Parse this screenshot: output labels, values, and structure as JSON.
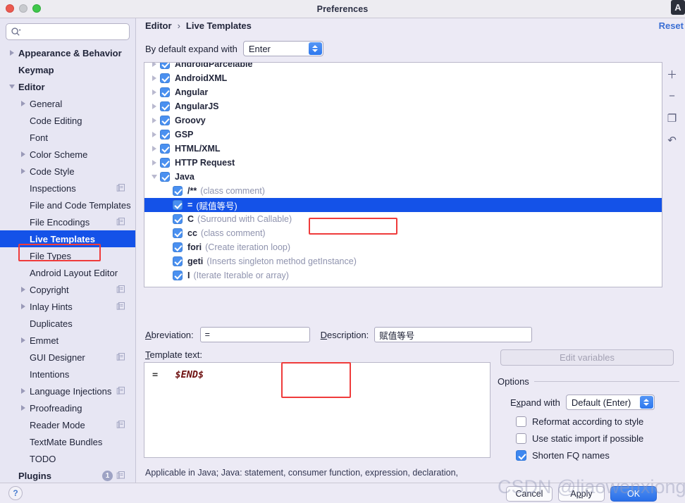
{
  "window": {
    "title": "Preferences",
    "corner_badge": "A",
    "traffic_lights": [
      "close-red",
      "minimize-gray",
      "maximize-green"
    ]
  },
  "sidebar": {
    "search": {
      "value": "",
      "placeholder": "",
      "icon": "search-icon"
    },
    "items": [
      {
        "label": "Appearance & Behavior",
        "arrow": "right",
        "indent": 1,
        "bold": true,
        "copy": false,
        "selected": false
      },
      {
        "label": "Keymap",
        "arrow": "none",
        "indent": 1,
        "bold": true,
        "copy": false,
        "selected": false
      },
      {
        "label": "Editor",
        "arrow": "down",
        "indent": 1,
        "bold": true,
        "copy": false,
        "selected": false
      },
      {
        "label": "General",
        "arrow": "right",
        "indent": 2,
        "bold": false,
        "copy": false,
        "selected": false
      },
      {
        "label": "Code Editing",
        "arrow": "none",
        "indent": 2,
        "bold": false,
        "copy": false,
        "selected": false
      },
      {
        "label": "Font",
        "arrow": "none",
        "indent": 2,
        "bold": false,
        "copy": false,
        "selected": false
      },
      {
        "label": "Color Scheme",
        "arrow": "right",
        "indent": 2,
        "bold": false,
        "copy": false,
        "selected": false
      },
      {
        "label": "Code Style",
        "arrow": "right",
        "indent": 2,
        "bold": false,
        "copy": false,
        "selected": false
      },
      {
        "label": "Inspections",
        "arrow": "none",
        "indent": 2,
        "bold": false,
        "copy": true,
        "selected": false
      },
      {
        "label": "File and Code Templates",
        "arrow": "none",
        "indent": 2,
        "bold": false,
        "copy": false,
        "selected": false
      },
      {
        "label": "File Encodings",
        "arrow": "none",
        "indent": 2,
        "bold": false,
        "copy": true,
        "selected": false
      },
      {
        "label": "Live Templates",
        "arrow": "none",
        "indent": 2,
        "bold": true,
        "copy": false,
        "selected": true
      },
      {
        "label": "File Types",
        "arrow": "none",
        "indent": 2,
        "bold": false,
        "copy": false,
        "selected": false
      },
      {
        "label": "Android Layout Editor",
        "arrow": "none",
        "indent": 2,
        "bold": false,
        "copy": false,
        "selected": false
      },
      {
        "label": "Copyright",
        "arrow": "right",
        "indent": 2,
        "bold": false,
        "copy": true,
        "selected": false
      },
      {
        "label": "Inlay Hints",
        "arrow": "right",
        "indent": 2,
        "bold": false,
        "copy": true,
        "selected": false
      },
      {
        "label": "Duplicates",
        "arrow": "none",
        "indent": 2,
        "bold": false,
        "copy": false,
        "selected": false
      },
      {
        "label": "Emmet",
        "arrow": "right",
        "indent": 2,
        "bold": false,
        "copy": false,
        "selected": false
      },
      {
        "label": "GUI Designer",
        "arrow": "none",
        "indent": 2,
        "bold": false,
        "copy": true,
        "selected": false
      },
      {
        "label": "Intentions",
        "arrow": "none",
        "indent": 2,
        "bold": false,
        "copy": false,
        "selected": false
      },
      {
        "label": "Language Injections",
        "arrow": "right",
        "indent": 2,
        "bold": false,
        "copy": true,
        "selected": false
      },
      {
        "label": "Proofreading",
        "arrow": "right",
        "indent": 2,
        "bold": false,
        "copy": false,
        "selected": false
      },
      {
        "label": "Reader Mode",
        "arrow": "none",
        "indent": 2,
        "bold": false,
        "copy": true,
        "selected": false
      },
      {
        "label": "TextMate Bundles",
        "arrow": "none",
        "indent": 2,
        "bold": false,
        "copy": false,
        "selected": false
      },
      {
        "label": "TODO",
        "arrow": "none",
        "indent": 2,
        "bold": false,
        "copy": false,
        "selected": false
      },
      {
        "label": "Plugins",
        "arrow": "none",
        "indent": 1,
        "bold": true,
        "copy": true,
        "selected": false,
        "badge": "1"
      }
    ]
  },
  "main": {
    "breadcrumb": {
      "parent": "Editor",
      "separator": "›",
      "current": "Live Templates"
    },
    "reset_label": "Reset",
    "expand_with": {
      "label": "By default expand with",
      "value": "Enter"
    },
    "templates": [
      {
        "name": "AndroidParcelable",
        "desc": "",
        "arrow": "right",
        "checked": true,
        "child": false,
        "selected": false
      },
      {
        "name": "AndroidXML",
        "desc": "",
        "arrow": "right",
        "checked": true,
        "child": false,
        "selected": false
      },
      {
        "name": "Angular",
        "desc": "",
        "arrow": "right",
        "checked": true,
        "child": false,
        "selected": false
      },
      {
        "name": "AngularJS",
        "desc": "",
        "arrow": "right",
        "checked": true,
        "child": false,
        "selected": false
      },
      {
        "name": "Groovy",
        "desc": "",
        "arrow": "right",
        "checked": true,
        "child": false,
        "selected": false
      },
      {
        "name": "GSP",
        "desc": "",
        "arrow": "right",
        "checked": true,
        "child": false,
        "selected": false
      },
      {
        "name": "HTML/XML",
        "desc": "",
        "arrow": "right",
        "checked": true,
        "child": false,
        "selected": false
      },
      {
        "name": "HTTP Request",
        "desc": "",
        "arrow": "right",
        "checked": true,
        "child": false,
        "selected": false
      },
      {
        "name": "Java",
        "desc": "",
        "arrow": "down",
        "checked": true,
        "child": false,
        "selected": false
      },
      {
        "name": "/**",
        "desc": "(class comment)",
        "arrow": "none",
        "checked": true,
        "child": true,
        "selected": false
      },
      {
        "name": "=",
        "desc": "(赋值等号)",
        "arrow": "none",
        "checked": true,
        "child": true,
        "selected": true
      },
      {
        "name": "C",
        "desc": "(Surround with Callable)",
        "arrow": "none",
        "checked": true,
        "child": true,
        "selected": false
      },
      {
        "name": "cc",
        "desc": "(class comment)",
        "arrow": "none",
        "checked": true,
        "child": true,
        "selected": false
      },
      {
        "name": "fori",
        "desc": "(Create iteration loop)",
        "arrow": "none",
        "checked": true,
        "child": true,
        "selected": false
      },
      {
        "name": "geti",
        "desc": "(Inserts singleton method getInstance)",
        "arrow": "none",
        "checked": true,
        "child": true,
        "selected": false
      },
      {
        "name": "I",
        "desc": "(Iterate Iterable or array)",
        "arrow": "none",
        "checked": true,
        "child": true,
        "selected": false
      }
    ],
    "toolbar": [
      {
        "icon": "plus-icon",
        "glyph": "＋"
      },
      {
        "icon": "minus-icon",
        "glyph": "−"
      },
      {
        "icon": "copy-icon",
        "glyph": "❐"
      },
      {
        "icon": "revert-icon",
        "glyph": "↶"
      }
    ],
    "abbreviation": {
      "label_pre": "A",
      "label_u": "b",
      "label_post": "breviation:",
      "value": "="
    },
    "description": {
      "label_pre": "",
      "label_u": "D",
      "label_post": "escription:",
      "value": "赋值等号"
    },
    "template_text": {
      "label": "Template text:",
      "equals": "=",
      "variable": "$END$"
    },
    "edit_variables_label": "Edit variables",
    "options": {
      "title": "Options",
      "expand_with": {
        "label_pre": "E",
        "label_u": "x",
        "label_post": "pand with",
        "value": "Default (Enter)"
      },
      "checkboxes": [
        {
          "label": "Reformat according to style",
          "checked": false
        },
        {
          "label": "Use static import if possible",
          "checked": false
        },
        {
          "label": "Shorten FQ names",
          "checked": true
        }
      ]
    },
    "applicable": "Applicable in Java; Java: statement, consumer function, expression, declaration,"
  },
  "footer": {
    "help": "?",
    "cancel": "Cancel",
    "apply": "Apply",
    "ok": "OK"
  },
  "overlay": {
    "watermark": "CSDN @liaowenxiong"
  },
  "colors": {
    "selection_blue": "#1452e8",
    "accent_blue": "#3b6fd4",
    "highlight_red": "#ef3b3b",
    "sidebar_bg": "#e7e6f3",
    "panel_bg": "#eceaf5"
  }
}
